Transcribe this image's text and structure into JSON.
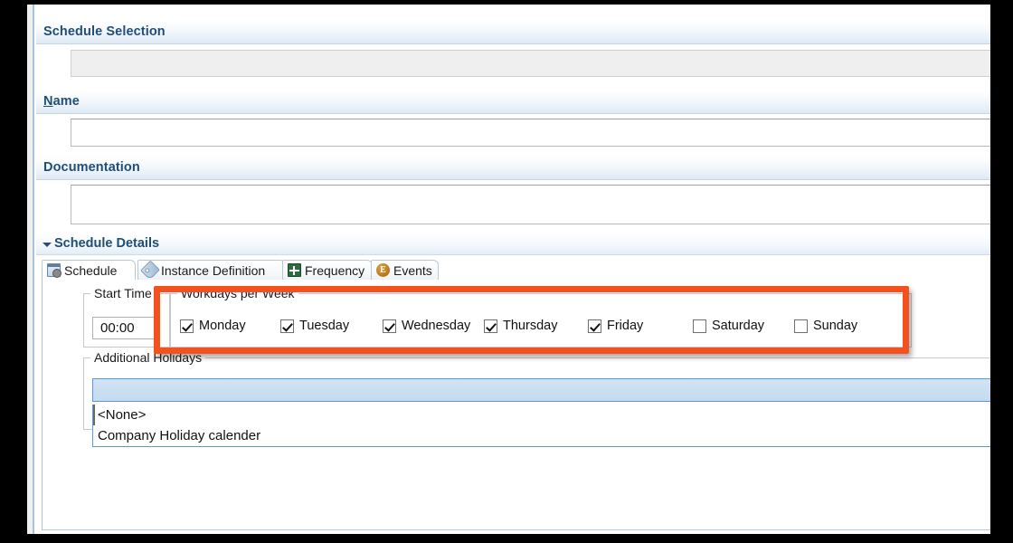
{
  "window": {
    "sections": [
      {
        "id": "schedule-selection",
        "title": "Schedule Selection"
      },
      {
        "id": "name",
        "title": "Name"
      },
      {
        "id": "documentation",
        "title": "Documentation"
      }
    ],
    "schedule_selection": {
      "value": ""
    },
    "name": {
      "value": "",
      "placeholder": ""
    },
    "documentation": {
      "value": "",
      "placeholder": ""
    }
  },
  "schedule_details": {
    "title": "Schedule Details",
    "expanded": true,
    "tabs": [
      {
        "label": "Schedule",
        "icon": "schedule-window-icon",
        "active": true
      },
      {
        "label": "Instance Definition",
        "icon": "tag-icon",
        "active": false
      },
      {
        "label": "Frequency",
        "icon": "frequency-waveform-icon",
        "active": false
      },
      {
        "label": "Events",
        "icon": "events-circle-icon",
        "icon_glyph": "E",
        "active": false
      }
    ],
    "start_time": {
      "legend": "Start Time",
      "value": "00:00"
    },
    "workdays": {
      "legend": "Workdays per Week",
      "days": [
        {
          "label": "Monday",
          "checked": true
        },
        {
          "label": "Tuesday",
          "checked": true
        },
        {
          "label": "Wednesday",
          "checked": true
        },
        {
          "label": "Thursday",
          "checked": true
        },
        {
          "label": "Friday",
          "checked": true
        },
        {
          "label": "Saturday",
          "checked": false
        },
        {
          "label": "Sunday",
          "checked": false
        }
      ]
    },
    "additional_holidays": {
      "legend": "Additional Holidays",
      "selected_value": "",
      "options": [
        "<None>",
        "Company Holiday calender"
      ]
    }
  },
  "annotation": {
    "highlight_color": "#f4511e",
    "target": "workdays-per-week-group"
  },
  "colors": {
    "header_text": "#1f4e79",
    "combo_border": "#5b9bd5",
    "combo_fill": "#c9dff2"
  }
}
